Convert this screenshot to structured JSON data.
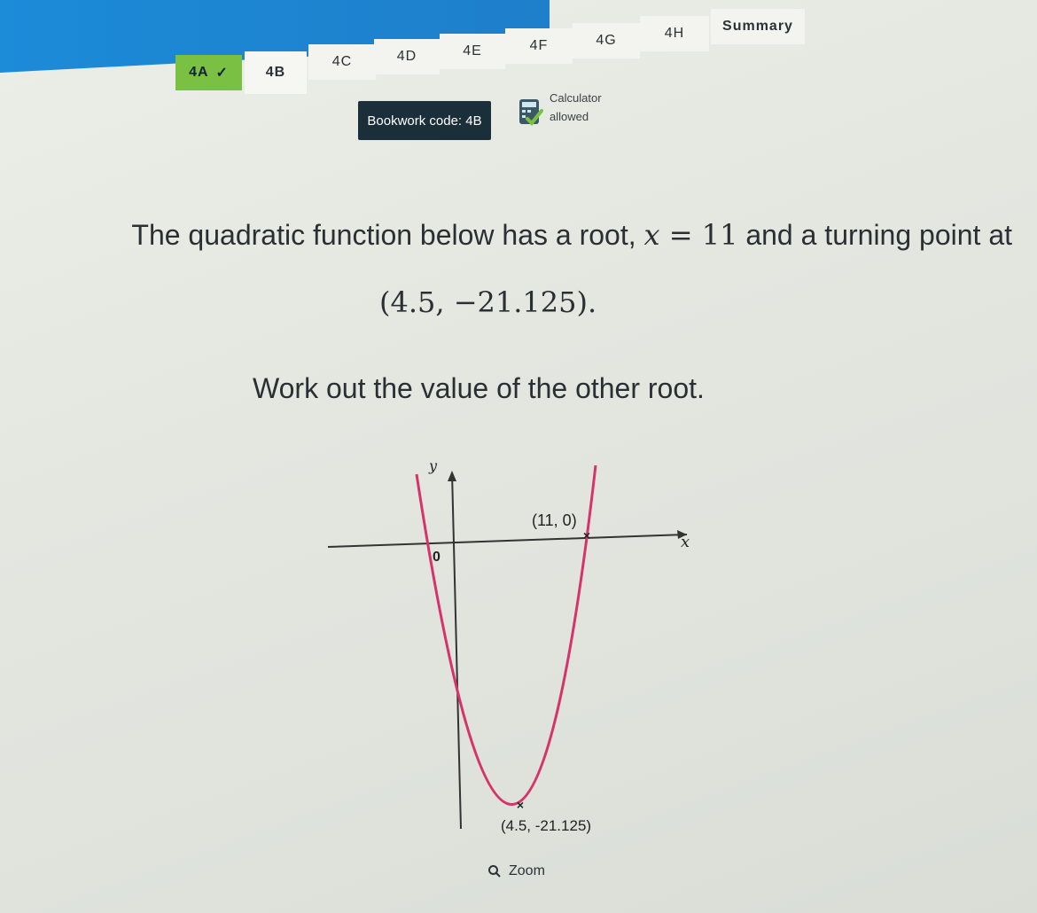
{
  "tabs": [
    {
      "label": "4A",
      "check": "✓"
    },
    {
      "label": "4B"
    },
    {
      "label": "4C"
    },
    {
      "label": "4D"
    },
    {
      "label": "4E"
    },
    {
      "label": "4F"
    },
    {
      "label": "4G"
    },
    {
      "label": "4H"
    },
    {
      "label": "Summary"
    }
  ],
  "bookwork": {
    "label": "Bookwork code: 4B"
  },
  "calculator": {
    "line1": "Calculator",
    "line2": "allowed"
  },
  "question": {
    "part1": "The quadratic function below has a root, ",
    "root_var": "x",
    "root_eq": " = 11",
    "part2": " and a turning point at",
    "coordinate": "(4.5, −21.125).",
    "task": "Work out the value of the other root."
  },
  "graph": {
    "y_label": "y",
    "x_label": "x",
    "origin_label": "0",
    "root_label": "(11, 0)",
    "turning_label": "(4.5, -21.125)",
    "curve_color": "#d6336c",
    "axis_color": "#333333"
  },
  "zoom": {
    "label": "Zoom",
    "icon": "magnifier-icon"
  }
}
